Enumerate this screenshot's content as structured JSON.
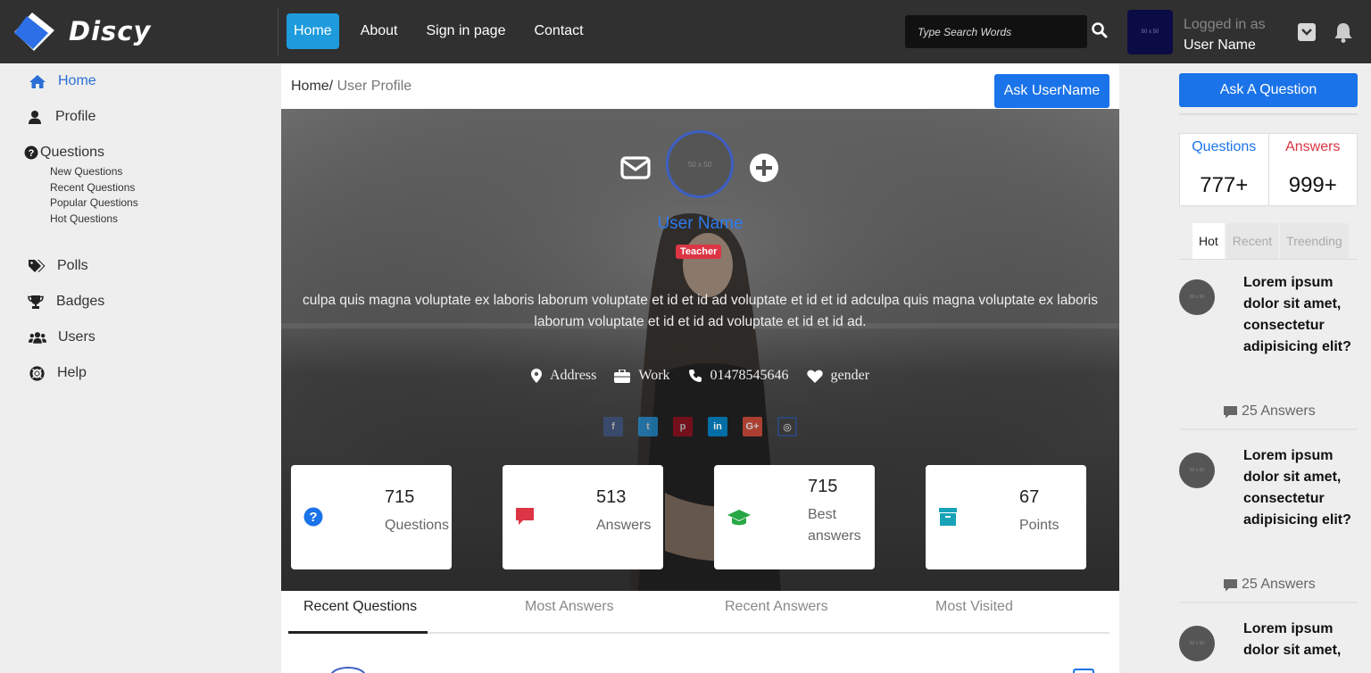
{
  "brand": {
    "name": "Discy"
  },
  "nav": {
    "items": [
      {
        "label": "Home",
        "active": true
      },
      {
        "label": "About",
        "active": false
      },
      {
        "label": "Sign in page",
        "active": false
      },
      {
        "label": "Contact",
        "active": false
      }
    ],
    "search_placeholder": "Type Search Words",
    "avatar_text": "50 x 50",
    "logged_in_label": "Logged in as",
    "user_name": "User Name"
  },
  "sidebar": {
    "home": "Home",
    "profile": "Profile",
    "questions": "Questions",
    "question_links": [
      "New Questions",
      "Recent Questions",
      "Popular Questions",
      "Hot Questions"
    ],
    "polls": "Polls",
    "badges": "Badges",
    "users": "Users",
    "help": "Help"
  },
  "breadcrumb": {
    "root": "Home/",
    "current": "User Profile"
  },
  "ask_user_button": "Ask UserName",
  "profile": {
    "avatar_text": "50 x 50",
    "name": "User Name",
    "role": "Teacher",
    "bio": "culpa quis magna voluptate ex laboris laborum voluptate et id et id ad voluptate et id et id adculpa quis magna voluptate ex laboris laborum voluptate et id et id ad voluptate et id et id ad.",
    "address": "Address",
    "work": "Work",
    "phone": "01478545646",
    "gender": "gender",
    "social": [
      "facebook",
      "twitter",
      "pinterest",
      "linkedin",
      "google-plus",
      "instagram"
    ]
  },
  "stats": [
    {
      "value": "715",
      "label": "Questions",
      "icon": "question-circle-icon",
      "color": "#1a73e8"
    },
    {
      "value": "513",
      "label": "Answers",
      "icon": "comment-icon",
      "color": "#dc3545"
    },
    {
      "value": "715",
      "label": "Best answers",
      "icon": "graduation-cap-icon",
      "color": "#28a745"
    },
    {
      "value": "67",
      "label": "Points",
      "icon": "archive-icon",
      "color": "#17a2b8"
    }
  ],
  "tabs": [
    "Recent Questions",
    "Most Answers",
    "Recent Answers",
    "Most Visited"
  ],
  "right": {
    "ask_question": "Ask A Question",
    "questions_label": "Questions",
    "questions_value": "777+",
    "answers_label": "Answers",
    "answers_value": "999+",
    "tabs": [
      "Hot",
      "Recent",
      "Treending"
    ],
    "posts": [
      {
        "avatar_text": "50 x 50",
        "title": "Lorem ipsum dolor sit amet, consectetur adipisicing elit?",
        "answers": "25 Answers"
      },
      {
        "avatar_text": "50 x 50",
        "title": "Lorem ipsum dolor sit amet, consectetur adipisicing elit?",
        "answers": "25 Answers"
      },
      {
        "avatar_text": "50 x 50",
        "title": "Lorem ipsum dolor sit amet,"
      }
    ]
  },
  "colors": {
    "primary": "#1a73e8",
    "nav_active": "#1e9bdc",
    "topbar": "#303030",
    "danger": "#dc3545"
  }
}
